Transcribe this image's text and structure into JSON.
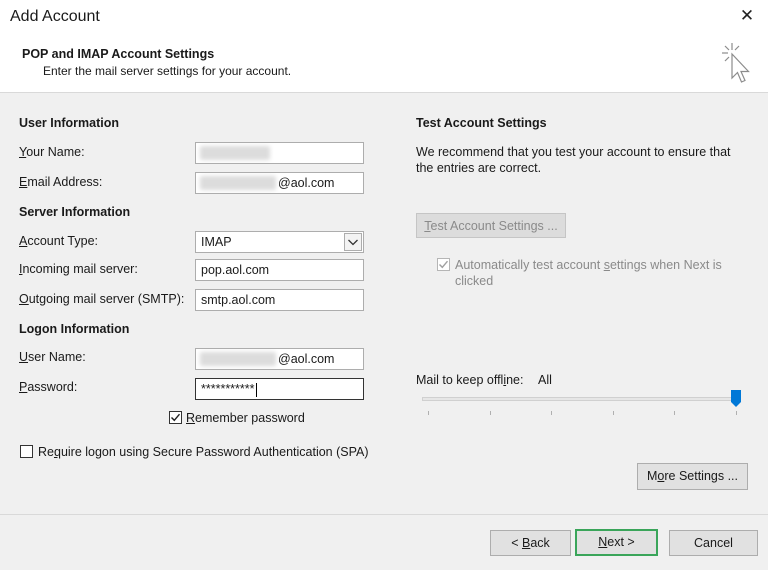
{
  "window": {
    "title": "Add Account"
  },
  "header": {
    "title": "POP and IMAP Account Settings",
    "subtitle": "Enter the mail server settings for your account."
  },
  "user_info": {
    "section": "User Information",
    "name_label_u": "Y",
    "name_label_rest": "our Name:",
    "email_label_u": "E",
    "email_label_rest": "mail Address:",
    "email_value": "@aol.com"
  },
  "server_info": {
    "section": "Server Information",
    "account_type_label_u": "A",
    "account_type_label_rest": "ccount Type:",
    "account_type_value": "IMAP",
    "incoming_label_u": "I",
    "incoming_label_rest": "ncoming mail server:",
    "incoming_value": "pop.aol.com",
    "outgoing_label_u": "O",
    "outgoing_label_rest": "utgoing mail server (SMTP):",
    "outgoing_value": "smtp.aol.com"
  },
  "logon_info": {
    "section": "Logon Information",
    "username_label_u": "U",
    "username_label_rest": "ser Name:",
    "username_value": "@aol.com",
    "password_label_u": "P",
    "password_label_rest": "assword:",
    "password_value": "***********",
    "remember_u": "R",
    "remember_rest": "emember password",
    "remember_checked": true,
    "spa_pre": "Re",
    "spa_u": "q",
    "spa_rest": "uire logon using Secure Password Authentication (SPA)",
    "spa_checked": false
  },
  "test": {
    "section": "Test Account Settings",
    "description": "We recommend that you test your account to ensure that the entries are correct.",
    "button_u": "T",
    "button_rest": "est Account Settings ...",
    "auto_pre": "Automatically test account ",
    "auto_u": "s",
    "auto_rest": "ettings when Next is clicked",
    "auto_checked": true
  },
  "offline": {
    "label_pre": "Mail to keep offl",
    "label_u": "i",
    "label_rest": "ne:",
    "value": "All",
    "slider_fraction": 1.0
  },
  "buttons": {
    "more_pre": "M",
    "more_u": "o",
    "more_rest": "re Settings ...",
    "back_pre": "< ",
    "back_u": "B",
    "back_rest": "ack",
    "next_u": "N",
    "next_rest": "ext >",
    "cancel": "Cancel"
  },
  "icons": {
    "close": "close-icon",
    "header": "cursor-sparkle-icon"
  }
}
